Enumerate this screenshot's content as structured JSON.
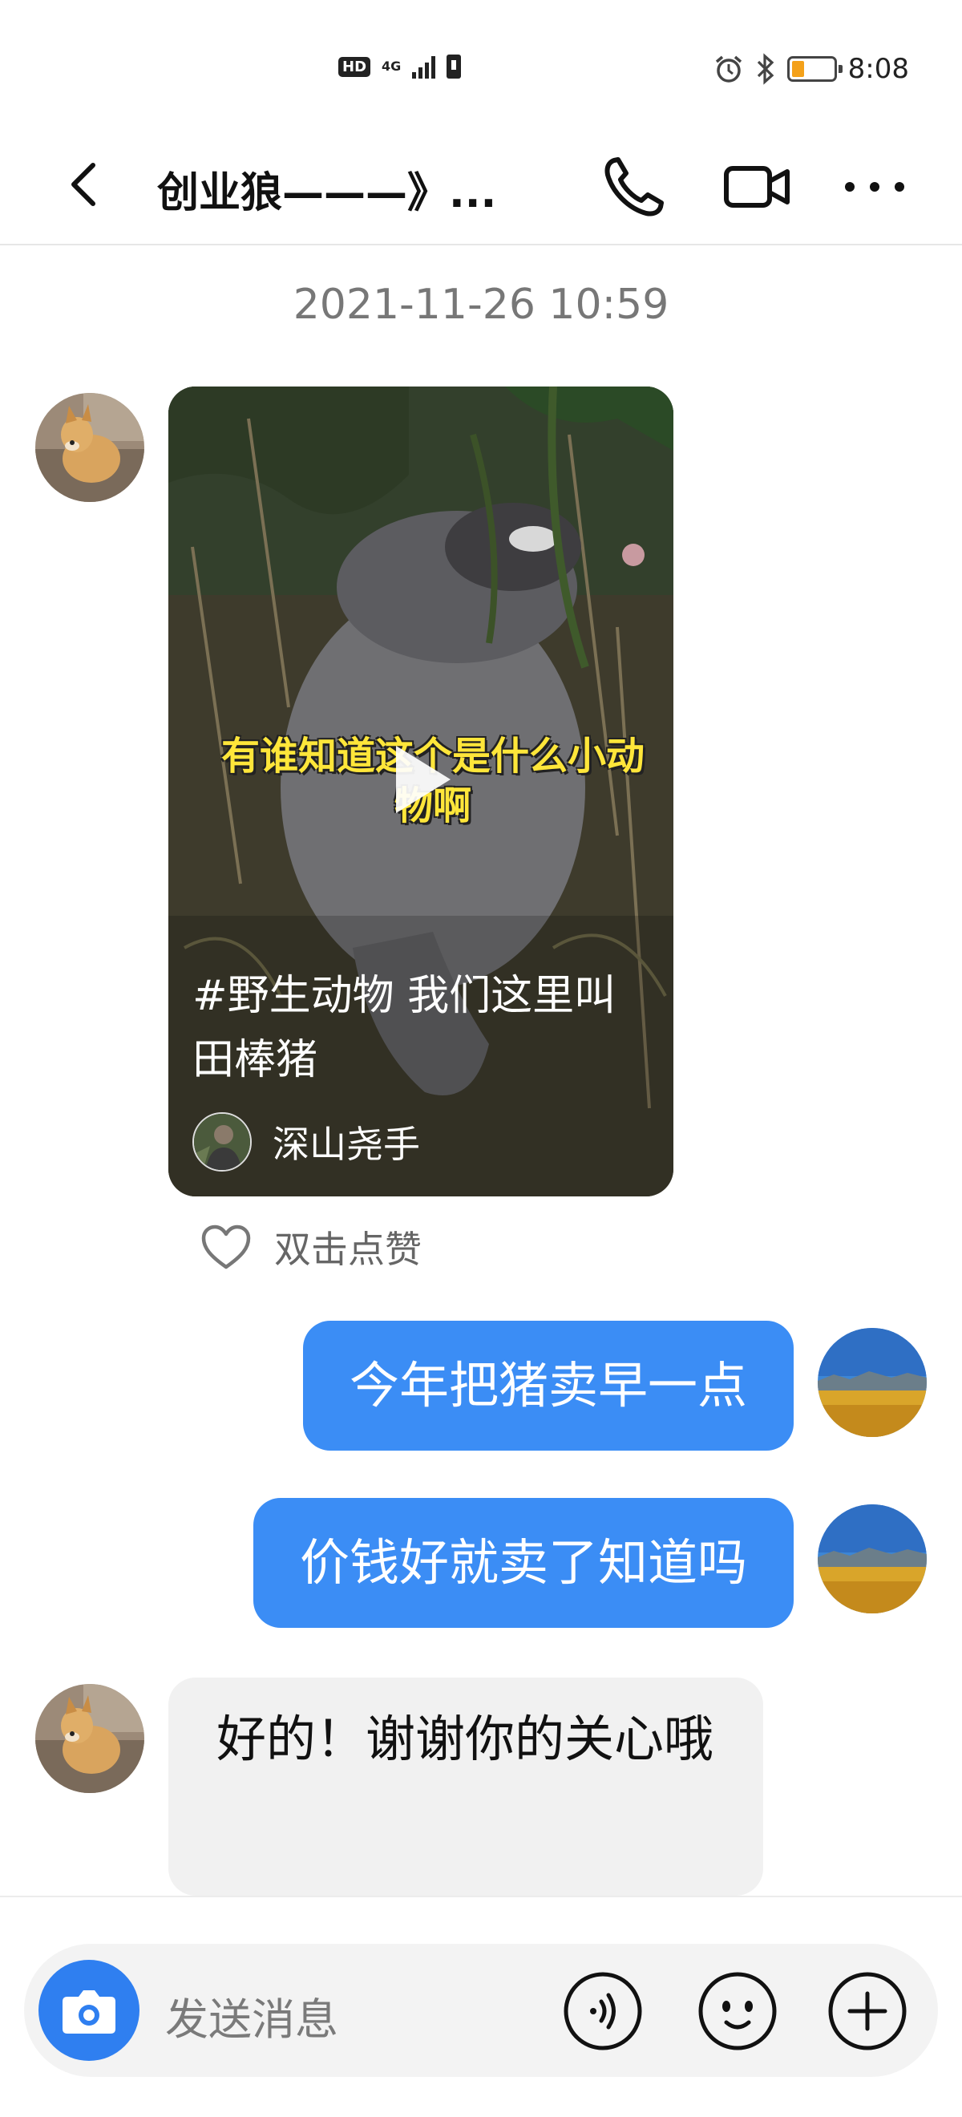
{
  "status_bar": {
    "hd": "HD",
    "network": "4G",
    "time": "8:08",
    "battery_level": 0.3
  },
  "header": {
    "title": "创业狼———》..."
  },
  "chat": {
    "timestamp": "2021-11-26 10:59",
    "video_card": {
      "caption": "有谁知道这个是什么小动物啊",
      "description": "#野生动物  我们这里叫田棒猪",
      "author": "深山尧手"
    },
    "like_label": "双击点赞",
    "messages": [
      {
        "side": "out",
        "text": "今年把猪卖早一点"
      },
      {
        "side": "out",
        "text": "价钱好就卖了知道吗"
      },
      {
        "side": "in",
        "text": "好的！谢谢你的关心哦"
      }
    ]
  },
  "input": {
    "placeholder": "发送消息"
  },
  "colors": {
    "accent": "#3b8df5",
    "camera": "#2f7ff0",
    "incoming_bubble": "#f1f1f1",
    "battery": "#f4a11a"
  },
  "icons": [
    "back-arrow-icon",
    "phone-icon",
    "video-call-icon",
    "more-icon",
    "play-icon",
    "heart-icon",
    "camera-icon",
    "voice-icon",
    "emoji-icon",
    "plus-icon"
  ]
}
